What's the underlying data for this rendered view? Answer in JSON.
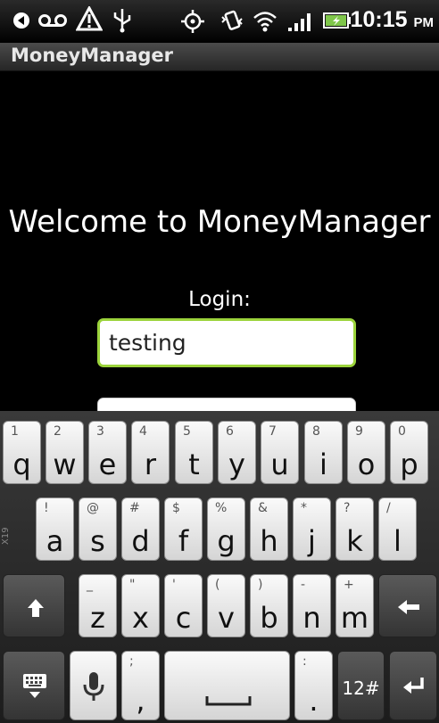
{
  "status": {
    "time": "10:15",
    "ampm": "PM"
  },
  "app": {
    "title": "MoneyManager"
  },
  "content": {
    "welcome": "Welcome to MoneyManager",
    "login_label": "Login:",
    "login_value": "testing",
    "password_value": ""
  },
  "keyboard": {
    "side_label": "X19",
    "row1": [
      {
        "main": "q",
        "alt": "1"
      },
      {
        "main": "w",
        "alt": "2"
      },
      {
        "main": "e",
        "alt": "3"
      },
      {
        "main": "r",
        "alt": "4"
      },
      {
        "main": "t",
        "alt": "5"
      },
      {
        "main": "y",
        "alt": "6"
      },
      {
        "main": "u",
        "alt": "7"
      },
      {
        "main": "i",
        "alt": "8"
      },
      {
        "main": "o",
        "alt": "9"
      },
      {
        "main": "p",
        "alt": "0"
      }
    ],
    "row2": [
      {
        "main": "a",
        "alt": "!"
      },
      {
        "main": "s",
        "alt": "@"
      },
      {
        "main": "d",
        "alt": "#"
      },
      {
        "main": "f",
        "alt": "$"
      },
      {
        "main": "g",
        "alt": "%"
      },
      {
        "main": "h",
        "alt": "&"
      },
      {
        "main": "j",
        "alt": "*"
      },
      {
        "main": "k",
        "alt": "?"
      },
      {
        "main": "l",
        "alt": "/"
      }
    ],
    "row3": [
      {
        "main": "z",
        "alt": "_"
      },
      {
        "main": "x",
        "alt": "\""
      },
      {
        "main": "c",
        "alt": "'"
      },
      {
        "main": "v",
        "alt": "("
      },
      {
        "main": "b",
        "alt": ")"
      },
      {
        "main": "n",
        "alt": "-"
      },
      {
        "main": "m",
        "alt": "+"
      }
    ],
    "comma": {
      "main": ",",
      "alt": ";"
    },
    "period": {
      "main": ".",
      "alt": ":"
    },
    "symbols_label": "12#",
    "shift_icon": "shift-arrow-icon",
    "backspace_icon": "backspace-arrow-icon",
    "keyboard_icon": "keyboard-hide-icon",
    "mic_icon": "microphone-icon",
    "space_icon": "spacebar-icon",
    "enter_icon": "enter-icon"
  }
}
